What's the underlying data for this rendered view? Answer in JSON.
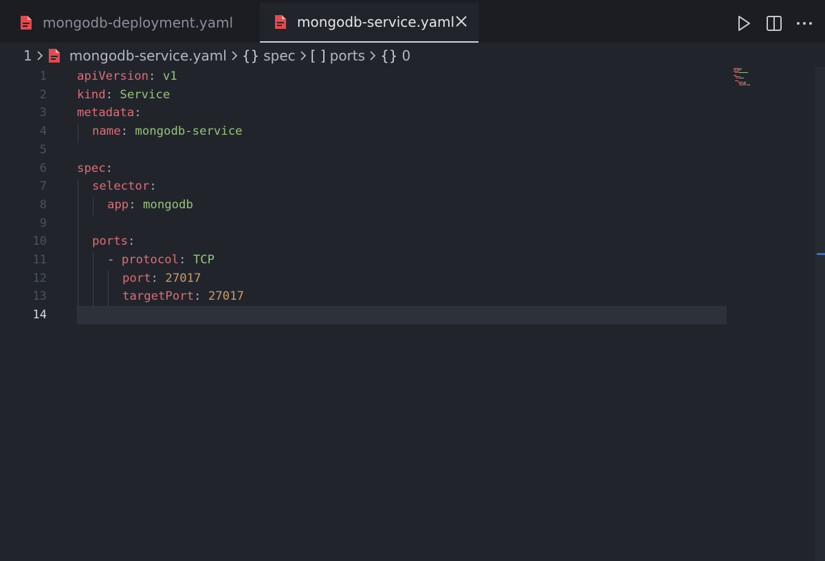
{
  "tabs": [
    {
      "label": "mongodb-deployment.yaml",
      "active": false
    },
    {
      "label": "mongodb-service.yaml",
      "active": true
    }
  ],
  "toolbar": {
    "run_icon": "play-icon",
    "split_icon": "split-editor-icon",
    "more_icon": "more-icon"
  },
  "breadcrumb": {
    "root": "1",
    "file": "mongodb-service.yaml",
    "spec_symbol": "{}",
    "spec": "spec",
    "ports_symbol": "[ ]",
    "ports": "ports",
    "item_symbol": "{}",
    "item": "0"
  },
  "editor": {
    "current_line": "14",
    "line_numbers": [
      "1",
      "2",
      "3",
      "4",
      "5",
      "6",
      "7",
      "8",
      "9",
      "10",
      "11",
      "12",
      "13",
      "14"
    ],
    "lines": [
      {
        "key": "apiVersion",
        "colon": ":",
        "value": " v1"
      },
      {
        "key": "kind",
        "colon": ":",
        "value": " Service"
      },
      {
        "key": "metadata",
        "colon": ":"
      },
      {
        "key": "name",
        "colon": ":",
        "value": " mongodb-service"
      },
      {},
      {
        "key": "spec",
        "colon": ":"
      },
      {
        "key": "selector",
        "colon": ":"
      },
      {
        "key": "app",
        "colon": ":",
        "value": " mongodb"
      },
      {},
      {
        "key": "ports",
        "colon": ":"
      },
      {
        "dash": "- ",
        "key": "protocol",
        "colon": ":",
        "value": " TCP"
      },
      {
        "key": "port",
        "colon": ":",
        "value": " 27017"
      },
      {
        "key": "targetPort",
        "colon": ":",
        "value": " 27017"
      },
      {}
    ]
  },
  "colors": {
    "key": "#e06c75",
    "string": "#98c379",
    "number": "#d19a66",
    "file_icon": "#e5484d"
  }
}
